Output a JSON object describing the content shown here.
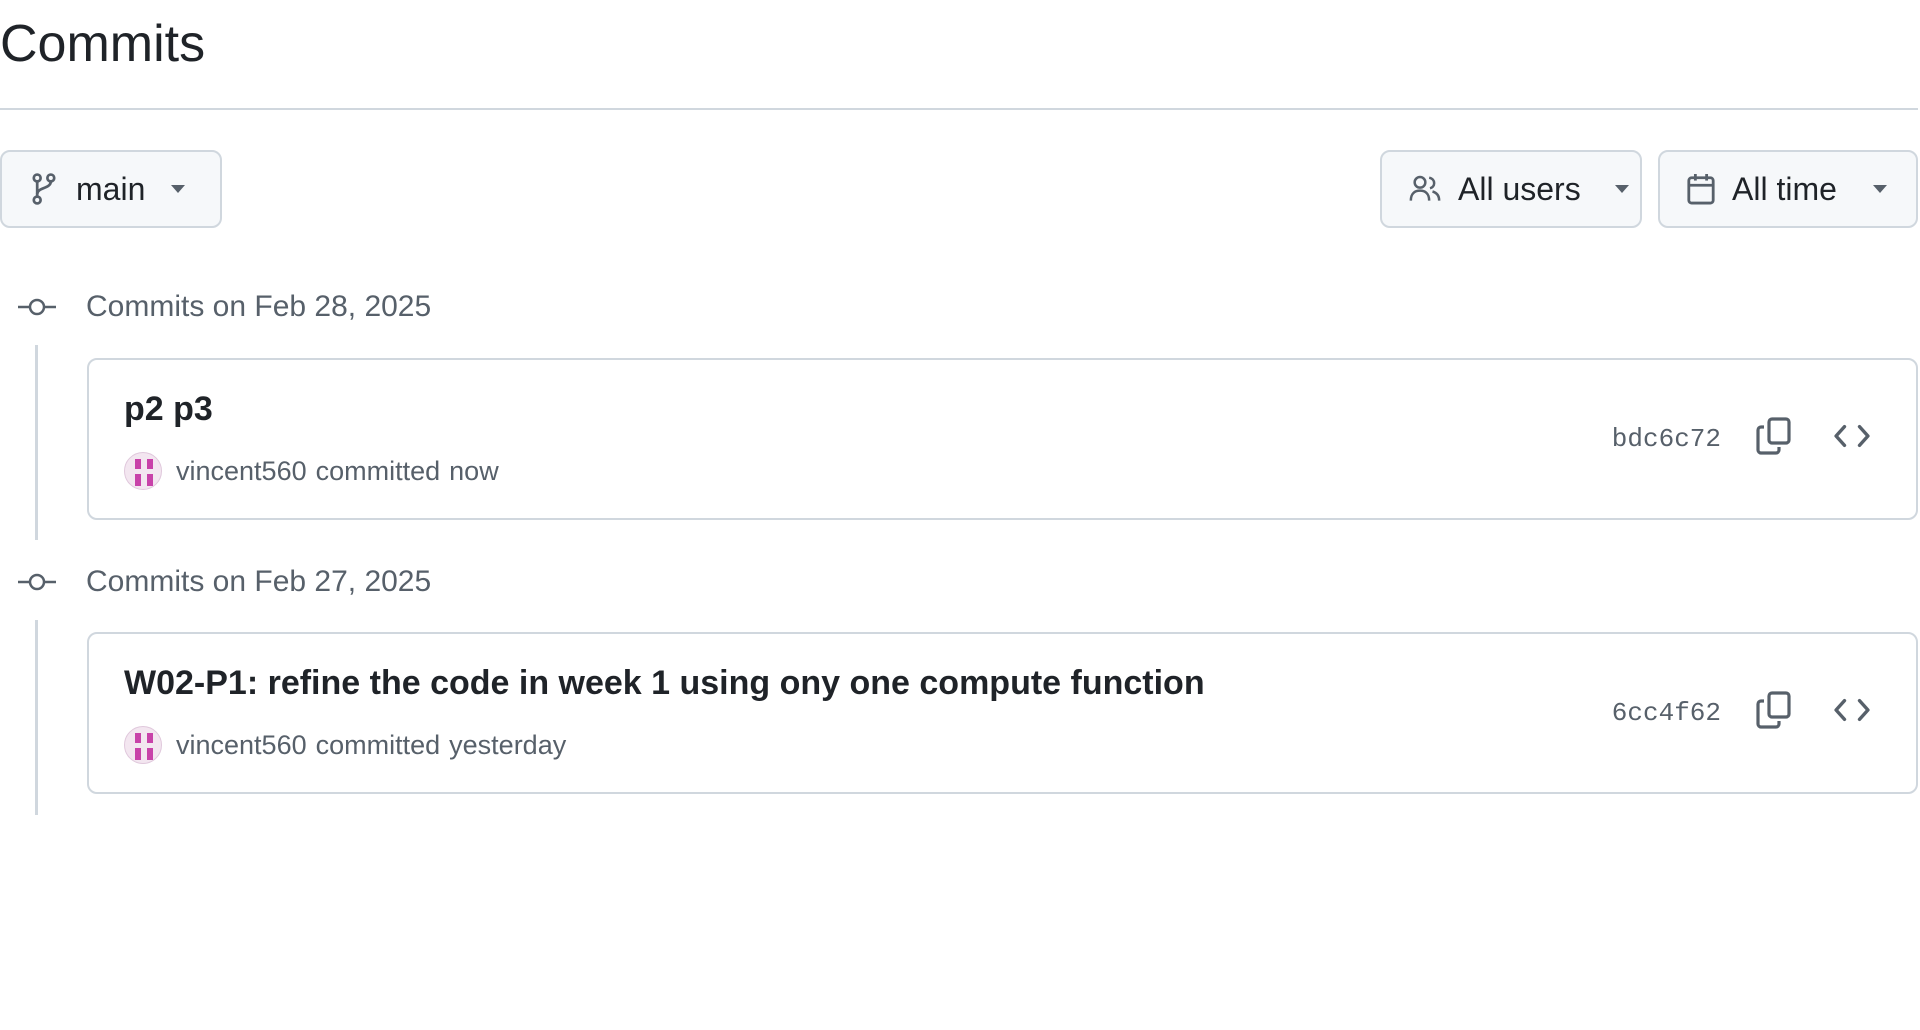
{
  "page": {
    "title": "Commits"
  },
  "filters": {
    "branch": {
      "label": "main",
      "icon": "git-branch-icon"
    },
    "users": {
      "label": "All users",
      "icon": "people-icon"
    },
    "time": {
      "label": "All time",
      "icon": "calendar-icon"
    }
  },
  "groups": [
    {
      "date_label": "Commits on Feb 28, 2025",
      "commits": [
        {
          "message": "p2 p3",
          "author": "vincent560",
          "verb": "committed",
          "when": "now",
          "sha": "bdc6c72"
        }
      ]
    },
    {
      "date_label": "Commits on Feb 27, 2025",
      "commits": [
        {
          "message": "W02-P1: refine the code in week 1 using ony one compute function",
          "author": "vincent560",
          "verb": "committed",
          "when": "yesterday",
          "sha": "6cc4f62"
        }
      ]
    }
  ],
  "colors": {
    "border": "#d0d7de",
    "muted": "#57606a",
    "text": "#1f2328",
    "avatar_accent": "#c842a9"
  }
}
